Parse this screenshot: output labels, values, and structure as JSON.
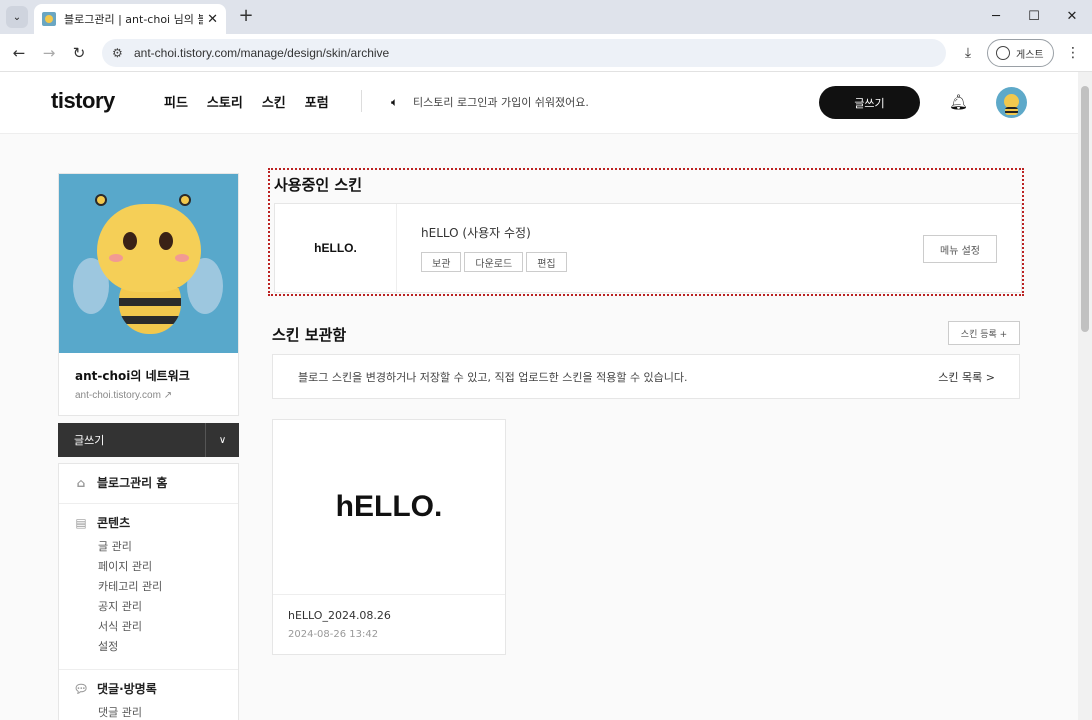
{
  "browser": {
    "tab_title": "블로그관리 | ant-choi 님의 블로그",
    "url": "ant-choi.tistory.com/manage/design/skin/archive",
    "guest_label": "게스트",
    "icons": [
      "tab-search-icon",
      "close-icon",
      "plus-icon",
      "minimize-icon",
      "maximize-icon",
      "close-window-icon",
      "back-icon",
      "forward-icon",
      "reload-icon",
      "site-info-icon",
      "download-icon",
      "profile-icon",
      "more-icon"
    ]
  },
  "header": {
    "logo": "tistory",
    "nav": [
      "피드",
      "스토리",
      "스킨",
      "포럼"
    ],
    "notice": "티스토리 로그인과 가입이 쉬워졌어요.",
    "write_label": "글쓰기"
  },
  "sidebar": {
    "blog_name": "ant-choi의 네트워크",
    "blog_url": "ant-choi.tistory.com",
    "write_label": "글쓰기",
    "home_label": "블로그관리 홈",
    "contents": {
      "label": "콘텐츠",
      "items": [
        "글 관리",
        "페이지 관리",
        "카테고리 관리",
        "공지 관리",
        "서식 관리",
        "설정"
      ]
    },
    "comments": {
      "label": "댓글·방명록",
      "items": [
        "댓글 관리"
      ]
    }
  },
  "main": {
    "current_skin_title": "사용중인 스킨",
    "current_skin": {
      "logo_text": "hELLO.",
      "name": "hELLO (사용자 수정)",
      "actions": [
        "보관",
        "다운로드",
        "편집"
      ],
      "menu_setting": "메뉴 설정"
    },
    "store_title": "스킨 보관함",
    "register_label": "스킨 등록 +",
    "info_text": "블로그 스킨을 변경하거나 저장할 수 있고, 직접 업로드한 스킨을 적용할 수 있습니다.",
    "skin_list_link": "스킨 목록 >",
    "stored_skins": [
      {
        "preview_text": "hELLO.",
        "name": "hELLO_2024.08.26",
        "date": "2024-08-26 13:42"
      }
    ]
  }
}
